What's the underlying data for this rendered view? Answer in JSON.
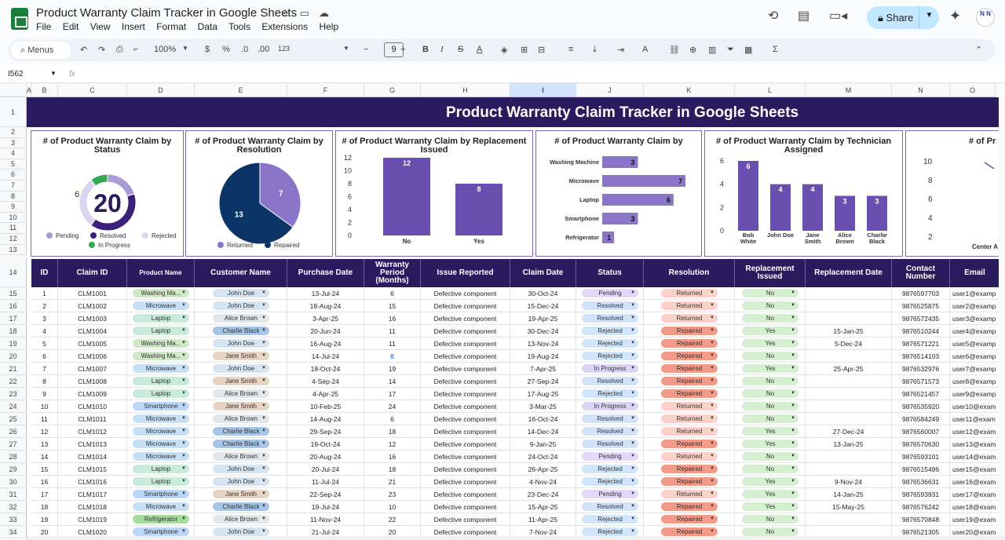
{
  "doc": {
    "title": "Product Warranty Claim Tracker in Google Sheets"
  },
  "menu": [
    "File",
    "Edit",
    "View",
    "Insert",
    "Format",
    "Data",
    "Tools",
    "Extensions",
    "Help"
  ],
  "share_label": "Share",
  "avatar_text": "N N",
  "toolbar": {
    "search": "Menus",
    "zoom": "100%",
    "currency": "$",
    "percent": "%",
    "dec_down": ".0",
    "dec_up": ".00",
    "number_fmt": "123",
    "font_size": "9",
    "minus": "−",
    "plus": "+"
  },
  "name_box": "I562",
  "fx": "fx",
  "columns": [
    "A",
    "B",
    "C",
    "D",
    "E",
    "F",
    "G",
    "H",
    "I",
    "J",
    "K",
    "L",
    "M",
    "N",
    "O"
  ],
  "selected_column": "I",
  "rows": [
    "1",
    "2",
    "3",
    "4",
    "5",
    "6",
    "7",
    "8",
    "9",
    "10",
    "11",
    "12",
    "13",
    "14",
    "15",
    "16",
    "17",
    "18",
    "19",
    "20",
    "21",
    "22",
    "23",
    "24",
    "25",
    "26",
    "27",
    "28",
    "29",
    "30",
    "31",
    "32",
    "33",
    "34"
  ],
  "banner_title": "Product Warranty Claim Tracker in Google Sheets",
  "charts": {
    "status": {
      "title": "# of Product Warranty Claim by Status",
      "center": "20",
      "side_label": "6",
      "legend": [
        "Pending",
        "Resolved",
        "Rejected",
        "In Progress"
      ]
    },
    "resolution": {
      "title": "# of Product Warranty Claim by Resolution",
      "legend": [
        "Returned",
        "Repaired"
      ]
    },
    "replacement": {
      "title": "# of Product Warranty Claim by Replacement Issued"
    },
    "product": {
      "title": "# of Product Warranty Claim by"
    },
    "technician": {
      "title": "# of Product Warranty Claim by Technician Assigned"
    },
    "cut": {
      "title": "# of Pr",
      "ticks": [
        "10",
        "8",
        "6",
        "4",
        "2"
      ],
      "cat": "Center A"
    }
  },
  "chart_data": [
    {
      "type": "pie",
      "title": "# of Product Warranty Claim by Status",
      "categories": [
        "Pending",
        "Resolved",
        "Rejected",
        "In Progress"
      ],
      "values": [
        4,
        8,
        6,
        2
      ],
      "total": 20,
      "colors": [
        "#a99bd3",
        "#3b1f7a",
        "#dcd5ef",
        "#34a853"
      ]
    },
    {
      "type": "pie",
      "title": "# of Product Warranty Claim by Resolution",
      "categories": [
        "Returned",
        "Repaired"
      ],
      "values": [
        7,
        13
      ],
      "colors": [
        "#8a75c9",
        "#0b3566"
      ]
    },
    {
      "type": "bar",
      "title": "# of Product Warranty Claim by Replacement Issued",
      "categories": [
        "No",
        "Yes"
      ],
      "values": [
        12,
        8
      ],
      "ylim": [
        0,
        12
      ],
      "ticks": [
        0,
        2,
        4,
        6,
        8,
        10,
        12
      ],
      "color": "#6b4fb0"
    },
    {
      "type": "bar",
      "orientation": "horizontal",
      "title": "# of Product Warranty Claim by",
      "categories": [
        "Washing Machine",
        "Microwave",
        "Laptop",
        "Smartphone",
        "Refrigerator"
      ],
      "values": [
        3,
        7,
        6,
        3,
        1
      ],
      "xlim": [
        0,
        7
      ],
      "color": "#8a75c9"
    },
    {
      "type": "bar",
      "title": "# of Product Warranty Claim by Technician Assigned",
      "categories": [
        "Bob White",
        "John Doe",
        "Jane Smith",
        "Alice Brown",
        "Charlie Black"
      ],
      "values": [
        6,
        4,
        4,
        3,
        3
      ],
      "ylim": [
        0,
        6
      ],
      "ticks": [
        0,
        2,
        4,
        6
      ],
      "color": "#6b4fb0"
    }
  ],
  "table": {
    "headers": [
      "ID",
      "Claim ID",
      "Product Name",
      "Customer Name",
      "Purchase Date",
      "Warranty Period (Months)",
      "Issue Reported",
      "Claim Date",
      "Status",
      "Resolution",
      "Replacement Issued",
      "Replacement Date",
      "Contact Number",
      "Email"
    ],
    "rows": [
      [
        "1",
        "CLM1001",
        "Washing Ma...",
        "John Doe",
        "13-Jul-24",
        "6",
        "Defective component",
        "30-Oct-24",
        "Pending",
        "Returned",
        "No",
        "",
        "9876597703",
        "user1@examp"
      ],
      [
        "2",
        "CLM1002",
        "Microwave",
        "John Doe",
        "18-Aug-24",
        "15",
        "Defective component",
        "15-Dec-24",
        "Resolved",
        "Returned",
        "No",
        "",
        "9876525875",
        "user2@examp"
      ],
      [
        "3",
        "CLM1003",
        "Laptop",
        "Alice Brown",
        "3-Apr-25",
        "16",
        "Defective component",
        "19-Apr-25",
        "Resolved",
        "Returned",
        "No",
        "",
        "9876572435",
        "user3@examp"
      ],
      [
        "4",
        "CLM1004",
        "Laptop",
        "Charlie Black",
        "20-Jun-24",
        "11",
        "Defective component",
        "30-Dec-24",
        "Rejected",
        "Repaired",
        "Yes",
        "15-Jan-25",
        "9876510244",
        "user4@examp"
      ],
      [
        "5",
        "CLM1005",
        "Washing Ma...",
        "John Doe",
        "16-Aug-24",
        "11",
        "Defective component",
        "13-Nov-24",
        "Rejected",
        "Repaired",
        "Yes",
        "5-Dec-24",
        "9876571221",
        "user5@examp"
      ],
      [
        "6",
        "CLM1006",
        "Washing Ma...",
        "Jane Smith",
        "14-Jul-24",
        "8",
        "Defective component",
        "19-Aug-24",
        "Rejected",
        "Repaired",
        "No",
        "",
        "9876514103",
        "user6@examp"
      ],
      [
        "7",
        "CLM1007",
        "Microwave",
        "John Doe",
        "18-Oct-24",
        "19",
        "Defective component",
        "7-Apr-25",
        "In Progress",
        "Repaired",
        "Yes",
        "25-Apr-25",
        "9876532976",
        "user7@examp"
      ],
      [
        "8",
        "CLM1008",
        "Laptop",
        "Jane Smith",
        "4-Sep-24",
        "14",
        "Defective component",
        "27-Sep-24",
        "Resolved",
        "Repaired",
        "No",
        "",
        "9876571573",
        "user8@examp"
      ],
      [
        "9",
        "CLM1009",
        "Laptop",
        "Alice Brown",
        "4-Apr-25",
        "17",
        "Defective component",
        "17-Aug-25",
        "Rejected",
        "Repaired",
        "No",
        "",
        "9876521457",
        "user9@examp"
      ],
      [
        "10",
        "CLM1010",
        "Smartphone",
        "Jane Smith",
        "10-Feb-25",
        "24",
        "Defective component",
        "3-Mar-25",
        "In Progress",
        "Returned",
        "No",
        "",
        "9876535920",
        "user10@exam"
      ],
      [
        "11",
        "CLM1011",
        "Microwave",
        "Alice Brown",
        "14-Aug-24",
        "6",
        "Defective component",
        "16-Oct-24",
        "Resolved",
        "Returned",
        "No",
        "",
        "9876584249",
        "user11@exam"
      ],
      [
        "12",
        "CLM1012",
        "Microwave",
        "Charlie Black",
        "29-Sep-24",
        "18",
        "Defective component",
        "14-Dec-24",
        "Resolved",
        "Returned",
        "Yes",
        "27-Dec-24",
        "9876560007",
        "user12@exam"
      ],
      [
        "13",
        "CLM1013",
        "Microwave",
        "Charlie Black",
        "19-Oct-24",
        "12",
        "Defective component",
        "9-Jan-25",
        "Resolved",
        "Repaired",
        "Yes",
        "13-Jan-25",
        "9876570630",
        "user13@exam"
      ],
      [
        "14",
        "CLM1014",
        "Microwave",
        "Alice Brown",
        "20-Aug-24",
        "16",
        "Defective component",
        "24-Oct-24",
        "Pending",
        "Returned",
        "No",
        "",
        "9876593101",
        "user14@exam"
      ],
      [
        "15",
        "CLM1015",
        "Laptop",
        "John Doe",
        "20-Jul-24",
        "18",
        "Defective component",
        "26-Apr-25",
        "Rejected",
        "Repaired",
        "No",
        "",
        "9876515496",
        "user15@exam"
      ],
      [
        "16",
        "CLM1016",
        "Laptop",
        "John Doe",
        "11-Jul-24",
        "21",
        "Defective component",
        "4-Nov-24",
        "Rejected",
        "Repaired",
        "Yes",
        "9-Nov-24",
        "9876536631",
        "user16@exam"
      ],
      [
        "17",
        "CLM1017",
        "Smartphone",
        "Jane Smith",
        "22-Sep-24",
        "23",
        "Defective component",
        "23-Dec-24",
        "Pending",
        "Returned",
        "Yes",
        "14-Jan-25",
        "9876593931",
        "user17@exam"
      ],
      [
        "18",
        "CLM1018",
        "Microwave",
        "Charlie Black",
        "19-Jul-24",
        "10",
        "Defective component",
        "15-Apr-25",
        "Resolved",
        "Repaired",
        "Yes",
        "15-May-25",
        "9876576242",
        "user18@exam"
      ],
      [
        "19",
        "CLM1019",
        "Refrigerator",
        "Alice Brown",
        "11-Nov-24",
        "22",
        "Defective component",
        "11-Apr-25",
        "Rejected",
        "Repaired",
        "No",
        "",
        "9876570848",
        "user19@exam"
      ],
      [
        "20",
        "CLM1020",
        "Smartphone",
        "John Doe",
        "21-Jul-24",
        "20",
        "Defective component",
        "7-Nov-24",
        "Rejected",
        "Repaired",
        "No",
        "",
        "9876521305",
        "user20@exam"
      ]
    ]
  },
  "chip_colors": {
    "product": {
      "Washing Ma...": "#cfe8c8",
      "Microwave": "#c6dff3",
      "Laptop": "#c9ead8",
      "Smartphone": "#bcd7f5",
      "Refrigerator": "#a8dba0"
    },
    "customer": {
      "John Doe": "#d6e4f0",
      "Alice Brown": "#e3e6ea",
      "Charlie Black": "#a9c5e4",
      "Jane Smith": "#e6d4c4"
    },
    "status": {
      "Pending": "#e3d8f7",
      "Resolved": "#d2e3f7",
      "Rejected": "#d2e6fb",
      "In Progress": "#dcd4f5"
    },
    "resolution": {
      "Returned": "#fbd0c8",
      "Repaired": "#f29a88"
    },
    "replacement": {
      "No": "#d6efd3",
      "Yes": "#d6efd3"
    }
  }
}
